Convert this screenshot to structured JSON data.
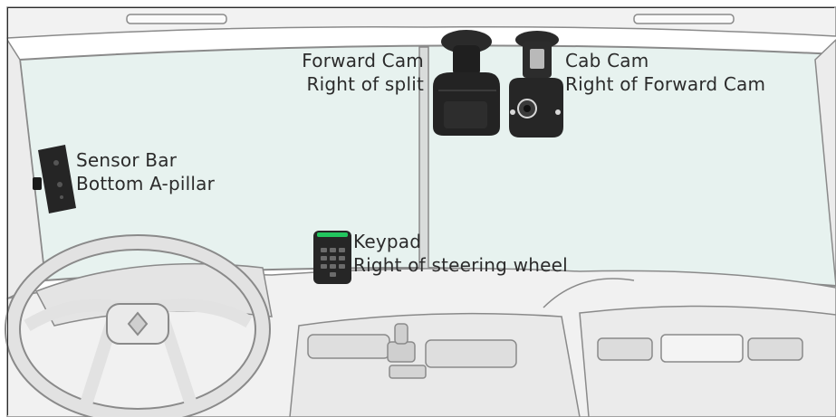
{
  "devices": [
    {
      "id": "forward-cam",
      "icon": "dashcam-icon",
      "name": "Forward Cam",
      "location": "Right of split"
    },
    {
      "id": "cab-cam",
      "icon": "cabin-camera-icon",
      "name": "Cab Cam",
      "location": "Right of Forward Cam"
    },
    {
      "id": "sensor-bar",
      "icon": "sensor-bar-icon",
      "name": "Sensor Bar",
      "location": "Bottom A-pillar"
    },
    {
      "id": "keypad",
      "icon": "keypad-icon",
      "name": "Keypad",
      "location": "Right of steering wheel"
    }
  ],
  "colors": {
    "line": "#8a8a8a",
    "fill": "#ececec",
    "windshield": "#e7f2ef",
    "device": "#1f1f1f",
    "keypad_led": "#22c55e",
    "text": "#2b2b2b"
  }
}
